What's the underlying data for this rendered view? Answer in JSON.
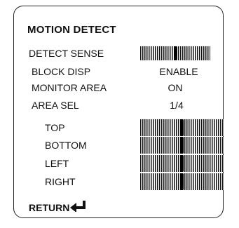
{
  "menu": {
    "title": "MOTION DETECT",
    "rows": {
      "detect_sense": {
        "label": "DETECT SENSE",
        "slider_level": 0.5
      },
      "block_disp": {
        "label": "BLOCK DISP",
        "value": "ENABLE"
      },
      "monitor_area": {
        "label": "MONITOR AREA",
        "value": "ON"
      },
      "area_sel": {
        "label": "AREA SEL",
        "value": "1/4"
      },
      "top": {
        "label": "TOP",
        "slider_level": 0.5
      },
      "bottom": {
        "label": "BOTTOM",
        "slider_level": 0.5
      },
      "left": {
        "label": "LEFT",
        "slider_level": 0.5
      },
      "right": {
        "label": "RIGHT",
        "slider_level": 0.5
      }
    },
    "return_label": "RETURN",
    "return_icon": "enter-return-arrow-icon"
  }
}
